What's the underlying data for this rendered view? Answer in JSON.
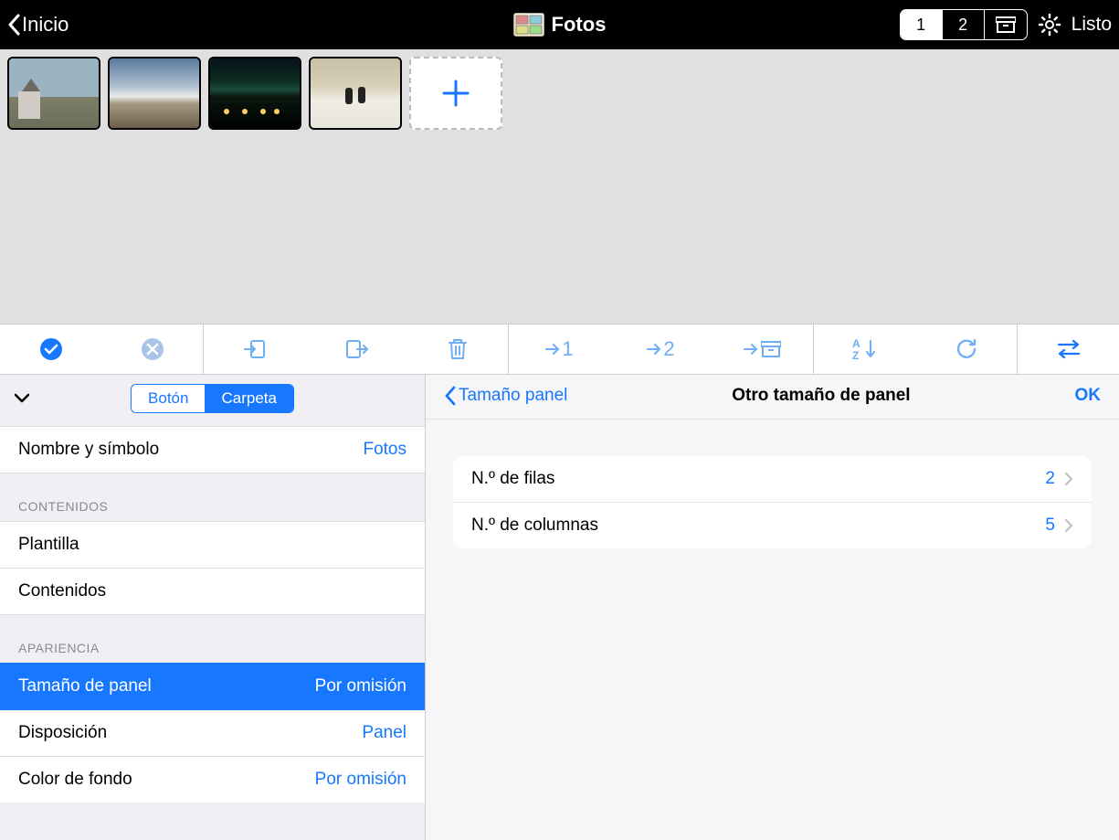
{
  "header": {
    "back_label": "Inicio",
    "title": "Fotos",
    "seg1": "1",
    "seg2": "2",
    "done_label": "Listo"
  },
  "thumbs": {
    "count": 4
  },
  "toolbar": {
    "to1": "→1",
    "to2": "→2"
  },
  "left": {
    "seg_button": "Botón",
    "seg_folder": "Carpeta",
    "name_symbol_label": "Nombre y símbolo",
    "name_symbol_value": "Fotos",
    "section_contents": "CONTENIDOS",
    "template_label": "Plantilla",
    "contents_label": "Contenidos",
    "section_appearance": "APARIENCIA",
    "panel_size_label": "Tamaño de panel",
    "panel_size_value": "Por omisión",
    "layout_label": "Disposición",
    "layout_value": "Panel",
    "bgcolor_label": "Color de fondo",
    "bgcolor_value": "Por omisión"
  },
  "right": {
    "back_label": "Tamaño panel",
    "title": "Otro tamaño de panel",
    "ok_label": "OK",
    "rows_label": "N.º de filas",
    "rows_value": "2",
    "cols_label": "N.º de columnas",
    "cols_value": "5"
  }
}
